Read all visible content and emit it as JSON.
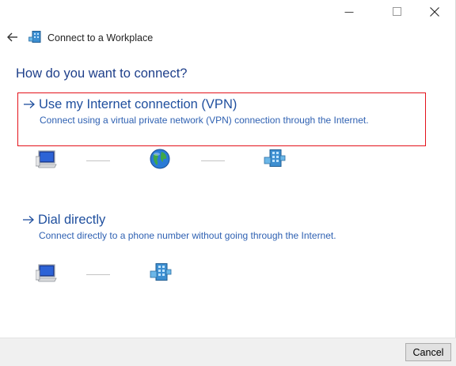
{
  "window": {
    "title": "Connect to a Workplace",
    "controls": [
      "minimize-icon",
      "maximize-icon",
      "close-icon"
    ]
  },
  "header": {
    "back_icon": "back-arrow-icon",
    "wizard_icon": "workplace-network-icon",
    "title": "Connect to a Workplace"
  },
  "main": {
    "heading": "How do you want to connect?",
    "options": [
      {
        "title": "Use my Internet connection (VPN)",
        "description": "Connect using a virtual private network (VPN) connection through the Internet.",
        "selected": true,
        "diagram": [
          "computer-icon",
          "globe-icon",
          "workplace-network-icon"
        ]
      },
      {
        "title": "Dial directly",
        "description": "Connect directly to a phone number without going through the Internet.",
        "selected": false,
        "diagram": [
          "computer-icon",
          "workplace-network-icon"
        ]
      }
    ]
  },
  "footer": {
    "cancel_label": "Cancel"
  },
  "colors": {
    "heading": "#1e3f8a",
    "link": "#1f4f9e",
    "selection_border": "#e4121a",
    "footer_bg": "#f0f0f0"
  }
}
